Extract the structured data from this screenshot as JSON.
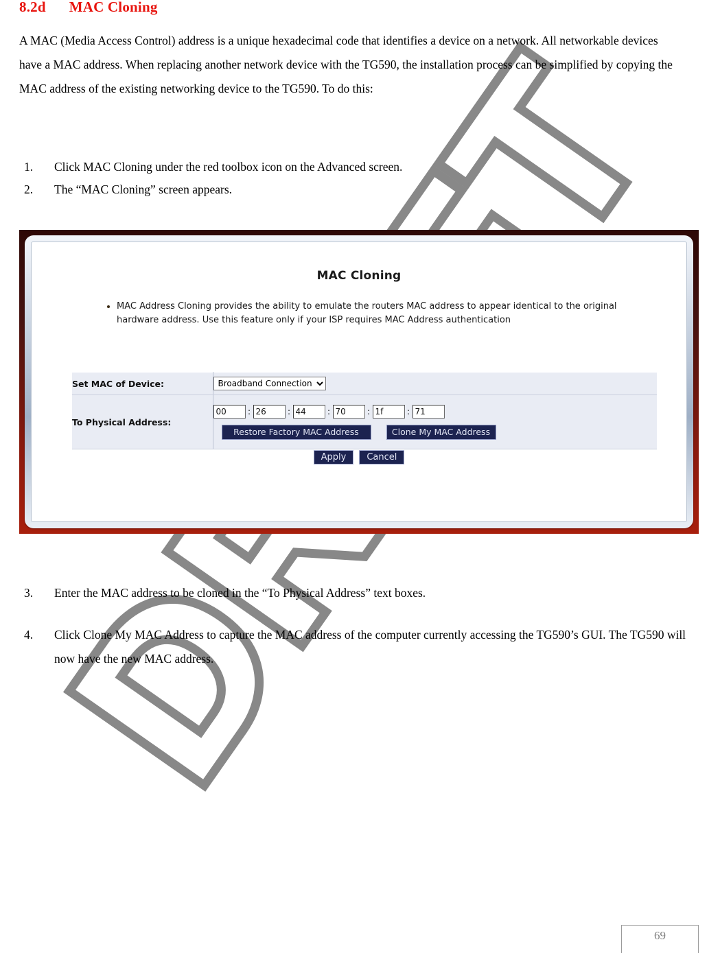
{
  "document": {
    "heading_number": "8.2d",
    "heading_title": "MAC Cloning",
    "intro_paragraph": "A MAC (Media Access Control) address is a unique hexadecimal code that identifies a device on a network. All networkable devices have a MAC address. When replacing another network device with the TG590, the installation process can be simplified by copying the MAC address of the existing networking device to the TG590. To do this:",
    "steps_top": [
      {
        "marker": "1.",
        "text": "Click MAC Cloning under the red toolbox icon on the Advanced screen."
      },
      {
        "marker": "2.",
        "text": "The “MAC Cloning” screen appears."
      }
    ],
    "steps_bottom": [
      {
        "marker": "3.",
        "text": "Enter the MAC address to be cloned in the “To Physical Address” text boxes."
      },
      {
        "marker": "4.",
        "text": "Click Clone My MAC Address to capture the MAC address of the computer currently accessing the TG590’s GUI. The TG590 will now have the new MAC address."
      }
    ],
    "page_number": "69",
    "watermark": "DRAFT"
  },
  "router_screen": {
    "title": "MAC Cloning",
    "bullets": [
      "MAC Address Cloning provides the ability to emulate the routers MAC address to appear identical to the original hardware address. Use this feature only if your ISP requires MAC Address authentication"
    ],
    "form": {
      "device_label": "Set MAC of Device:",
      "device_selected": "Broadband Connection",
      "device_options": [
        "Broadband Connection"
      ],
      "physical_label": "To Physical Address:",
      "mac_octets": [
        "00",
        "26",
        "44",
        "70",
        "1f",
        "71"
      ],
      "mac_separator": ":",
      "restore_button": "Restore Factory MAC Address",
      "clone_button": "Clone My MAC Address",
      "apply_button": "Apply",
      "cancel_button": "Cancel"
    }
  },
  "colors": {
    "heading_red": "#e8150f",
    "panel_border_dark": "#2d0806",
    "panel_border_red": "#a81f0d",
    "button_navy": "#1c2350",
    "table_bg": "#e9ecf4",
    "watermark_gray": "#888888"
  }
}
